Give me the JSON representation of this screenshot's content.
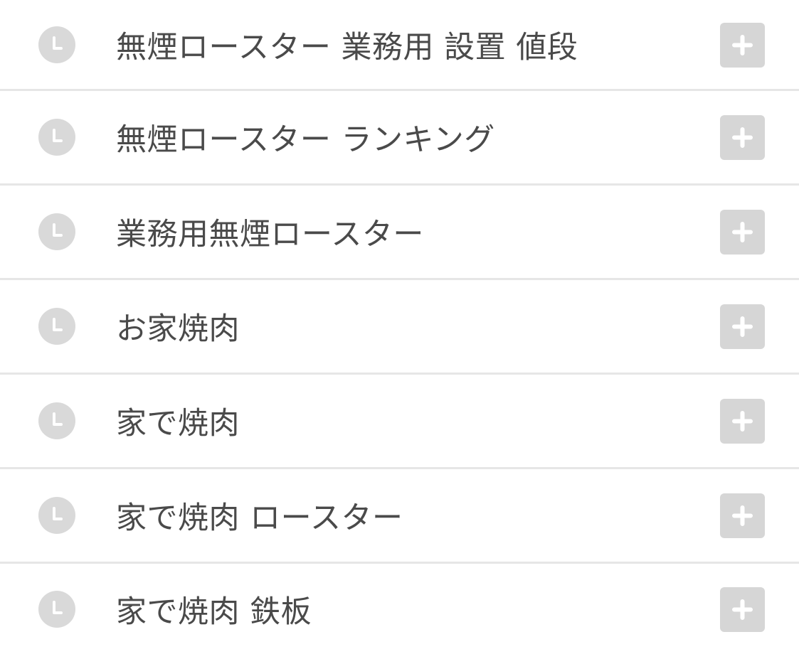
{
  "suggestions": [
    {
      "text": "無煙ロースター 業務用 設置 値段",
      "icon": "clock-icon",
      "action_icon": "plus-icon"
    },
    {
      "text": "無煙ロースター ランキング",
      "icon": "clock-icon",
      "action_icon": "plus-icon"
    },
    {
      "text": "業務用無煙ロースター",
      "icon": "clock-icon",
      "action_icon": "plus-icon"
    },
    {
      "text": "お家焼肉",
      "icon": "clock-icon",
      "action_icon": "plus-icon"
    },
    {
      "text": "家で焼肉",
      "icon": "clock-icon",
      "action_icon": "plus-icon"
    },
    {
      "text": "家で焼肉 ロースター",
      "icon": "clock-icon",
      "action_icon": "plus-icon"
    },
    {
      "text": "家で焼肉 鉄板",
      "icon": "clock-icon",
      "action_icon": "plus-icon"
    }
  ],
  "colors": {
    "text": "#4a4a4a",
    "icon_bg": "#d9d9d9",
    "button_bg": "#d6d6d6",
    "divider": "#e6e6e6",
    "background": "#ffffff"
  }
}
